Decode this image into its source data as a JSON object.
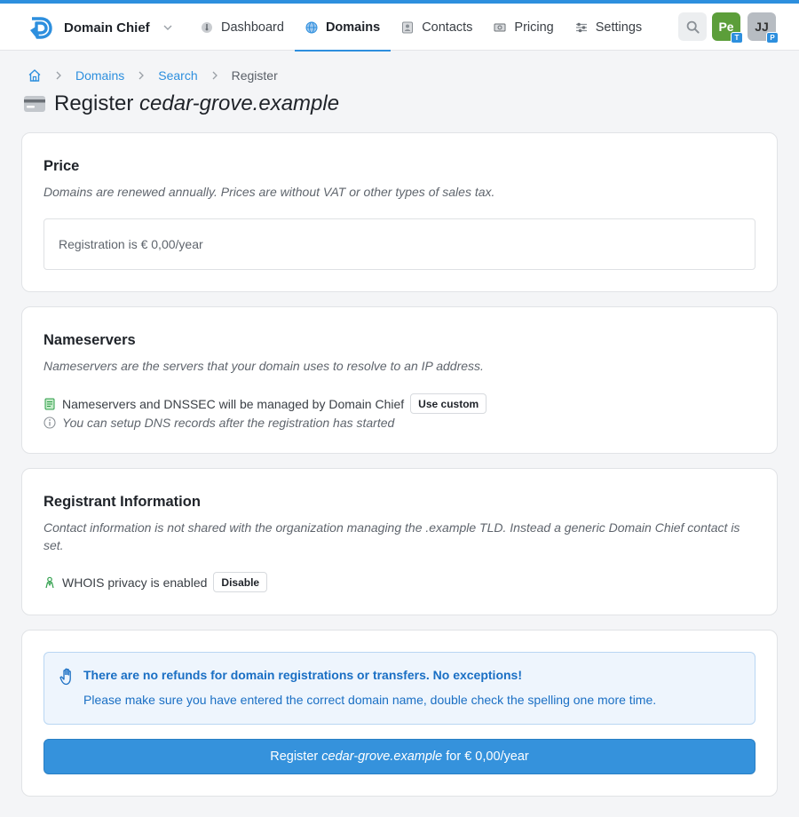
{
  "app": {
    "name": "Domain Chief"
  },
  "nav": {
    "items": [
      {
        "label": "Dashboard",
        "icon": "dashboard-icon",
        "active": false
      },
      {
        "label": "Domains",
        "icon": "globe-icon",
        "active": true
      },
      {
        "label": "Contacts",
        "icon": "contacts-icon",
        "active": false
      },
      {
        "label": "Pricing",
        "icon": "pricing-icon",
        "active": false
      },
      {
        "label": "Settings",
        "icon": "sliders-icon",
        "active": false
      }
    ]
  },
  "user": {
    "avatars": [
      {
        "initials": "Pe",
        "badge": "T",
        "color": "#5c9e3a"
      },
      {
        "initials": "JJ",
        "badge": "P",
        "color": "#b7bcc2"
      }
    ]
  },
  "breadcrumb": {
    "items": [
      "Domains",
      "Search"
    ],
    "current": "Register"
  },
  "page": {
    "title_prefix": "Register",
    "domain": "cedar-grove.example"
  },
  "price": {
    "heading": "Price",
    "description": "Domains are renewed annually. Prices are without VAT or other types of sales tax.",
    "registration_text": "Registration is € 0,00/year"
  },
  "nameservers": {
    "heading": "Nameservers",
    "description": "Nameservers are the servers that your domain uses to resolve to an IP address.",
    "managed_text": "Nameservers and DNSSEC will be managed by Domain Chief",
    "use_custom_label": "Use custom",
    "info_text": "You can setup DNS records after the registration has started"
  },
  "registrant": {
    "heading": "Registrant Information",
    "description": "Contact information is not shared with the organization managing the .example TLD. Instead a generic Domain Chief contact is set.",
    "whois_text": "WHOIS privacy is enabled",
    "disable_label": "Disable"
  },
  "notice": {
    "title": "There are no refunds for domain registrations or transfers. No exceptions!",
    "body": "Please make sure you have entered the correct domain name, double check the spelling one more time."
  },
  "register_button": {
    "prefix": "Register ",
    "domain": "cedar-grove.example",
    "suffix": " for € 0,00/year"
  },
  "colors": {
    "accent": "#2d8fde",
    "button": "#3592dc",
    "notice_text": "#1a6fc4"
  }
}
